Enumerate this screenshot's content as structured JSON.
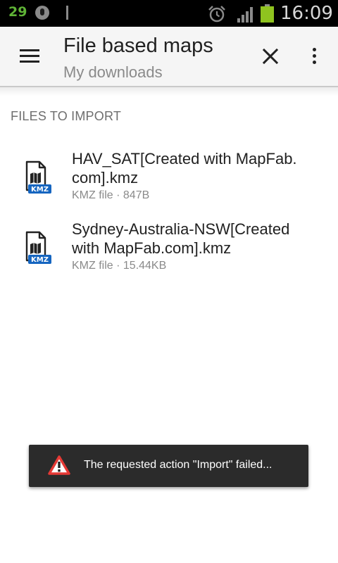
{
  "status_bar": {
    "notification_count": "29",
    "clock": "16:09",
    "colors": {
      "background": "#000000",
      "count": "#5fb336",
      "battery": "#8fc31f"
    }
  },
  "app_bar": {
    "title": "File based maps",
    "subtitle": "My downloads",
    "icons": {
      "menu": "hamburger-menu-icon",
      "close": "close-icon",
      "overflow": "overflow-menu-icon"
    }
  },
  "list": {
    "section_header": "FILES TO IMPORT",
    "files": [
      {
        "name": "HAV_SAT[Created with MapFab.com].kmz",
        "name_line1": "HAV_SAT[Created with MapFab.",
        "name_line2": "com].kmz",
        "meta": "KMZ file · 847B",
        "badge": "KMZ",
        "icon": "kmz-file-icon"
      },
      {
        "name": "Sydney-Australia-NSW[Created with MapFab.com].kmz",
        "name_line1": "Sydney-Australia-NSW[Created",
        "name_line2": "with MapFab.com].kmz",
        "meta": "KMZ file · 15.44KB",
        "badge": "KMZ",
        "icon": "kmz-file-icon"
      }
    ]
  },
  "toast": {
    "message": "The requested action \"Import\" failed...",
    "icon": "warning-icon",
    "colors": {
      "background": "#2b2b2b",
      "warning": "#e53935"
    }
  }
}
